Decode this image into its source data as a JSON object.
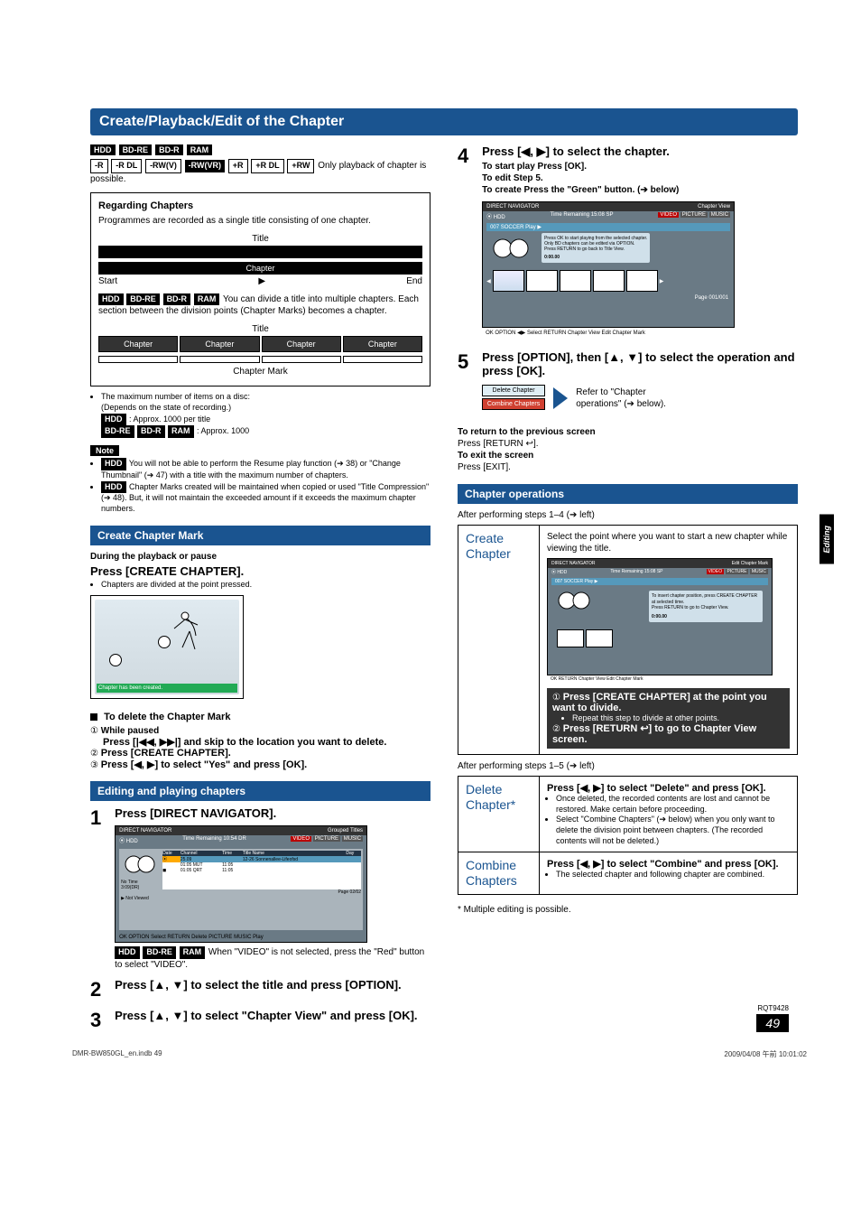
{
  "heading": "Create/Playback/Edit of the Chapter",
  "media_badges_line1": [
    "HDD",
    "BD-RE",
    "BD-R",
    "RAM"
  ],
  "media_badges_line2": [
    "-R",
    "-R DL",
    "-RW(V)",
    "-RW(VR)",
    "+R",
    "+R DL",
    "+RW"
  ],
  "media_line2_tail": "Only playback of chapter is possible.",
  "regarding": {
    "title": "Regarding Chapters",
    "desc": "Programmes are recorded as a single title consisting of one chapter.",
    "title_label": "Title",
    "chapter_label": "Chapter",
    "start": "Start",
    "end": "End",
    "divide_badges": [
      "HDD",
      "BD-RE",
      "BD-R",
      "RAM"
    ],
    "divide_text": "You can divide a title into multiple chapters. Each section between the division points (Chapter Marks) becomes a chapter.",
    "chapter_cell": "Chapter",
    "chapter_mark": "Chapter Mark"
  },
  "disc_notes": {
    "intro": "The maximum number of items on a disc:",
    "depends": "(Depends on the state of recording.)",
    "hdd_badge": "HDD",
    "hdd_text": ": Approx. 1000 per title",
    "other_badges": [
      "BD-RE",
      "BD-R",
      "RAM"
    ],
    "other_text": ": Approx. 1000"
  },
  "note": {
    "label": "Note",
    "b1_badge": "HDD",
    "b1": "You will not be able to perform the Resume play function (➔ 38) or \"Change Thumbnail\" (➔ 47) with a title with the maximum number of chapters.",
    "b2_badge": "HDD",
    "b2": "Chapter Marks created will be maintained when copied or used \"Title Compression\" (➔ 48). But, it will not maintain the exceeded amount if it exceeds the maximum chapter numbers."
  },
  "create_mark": {
    "heading": "Create Chapter Mark",
    "during": "During the playback or pause",
    "press": "Press [CREATE CHAPTER].",
    "divided": "Chapters are divided at the point pressed.",
    "created": "Chapter has been created."
  },
  "delete_mark": {
    "heading": "To delete the Chapter Mark",
    "s1_label": "While paused",
    "s1": "Press [|◀◀, ▶▶|] and skip to the location you want to delete.",
    "s2": "Press [CREATE CHAPTER].",
    "s3": "Press [◀, ▶] to select \"Yes\" and press [OK]."
  },
  "editing": {
    "heading": "Editing and playing chapters",
    "step1_title": "Press [DIRECT NAVIGATOR].",
    "nav": {
      "title": "DIRECT NAVIGATOR",
      "grouped": "Grouped Titles",
      "hdd": "HDD",
      "time_remaining": "Time Remaining  10:54  DR",
      "tabs": [
        "VIDEO",
        "PICTURE",
        "MUSIC"
      ],
      "cols": [
        "Date",
        "Channel",
        "Time",
        "Title Name",
        "Day"
      ],
      "rows": [
        [
          "25.09",
          "",
          "",
          "12-26 Sonnenallee-Lifeofsd",
          ""
        ],
        [
          "",
          "01:05 MUT",
          "11:05",
          "",
          ""
        ],
        [
          "",
          "01:05 QRT",
          "11:05",
          "",
          ""
        ]
      ],
      "no_time": "No Time",
      "code": "3:09(DR)",
      "not_viewed": "Not Viewed",
      "page": "Page 02/02",
      "footer": "OK  OPTION  Select  RETURN  Delete  PICTURE  MUSIC  Play"
    },
    "nav_note_badges": [
      "HDD",
      "BD-RE",
      "RAM"
    ],
    "nav_note": "When \"VIDEO\" is not selected, press the \"Red\" button to select \"VIDEO\".",
    "step2_title": "Press [▲, ▼] to select the title and press [OPTION].",
    "step3_title": "Press [▲, ▼] to select \"Chapter View\" and press [OK].",
    "step4_title": "Press [◀, ▶] to select the chapter.",
    "step4_sub1": "To start play  Press [OK].",
    "step4_sub2": "To edit  Step 5.",
    "step4_sub3": "To create  Press the \"Green\" button. (➔ below)",
    "chapter_view": {
      "title": "DIRECT NAVIGATOR",
      "sub": "Chapter View",
      "hdd": "HDD",
      "time_remaining": "Time Remaining  15:08  SP",
      "tabs": [
        "VIDEO",
        "PICTURE",
        "MUSIC"
      ],
      "row": "007   SOCCER        Play ▶",
      "info1": "Press OK to start playing from the selected chapter.",
      "info2": "Only BD chapters can be edited via OPTION.",
      "info3": "Press RETURN to go back to Title View.",
      "time": "0:00.00",
      "page": "Page 001/001",
      "footer": "OK  OPTION  ◀▶ Select  RETURN  Chapter View   Edit Chapter Mark"
    },
    "step5_title": "Press [OPTION], then [▲, ▼] to select the operation and press [OK].",
    "op_delete": "Delete Chapter",
    "op_combine": "Combine Chapters",
    "op_ref": "Refer to \"Chapter operations\" (➔ below).",
    "return_prev_h": "To return to the previous screen",
    "return_prev": "Press [RETURN ↩].",
    "exit_h": "To exit the screen",
    "exit": "Press [EXIT]."
  },
  "chapter_ops": {
    "heading": "Chapter operations",
    "after14": "After performing steps 1–4 (➔ left)",
    "create_label": "Create Chapter",
    "create_desc": "Select the point where you want to start a new chapter while viewing the title.",
    "ecp": {
      "title": "DIRECT NAVIGATOR",
      "sub": "Edit Chapter Mark",
      "hdd": "HDD",
      "time_remaining": "Time Remaining  15:08  SP",
      "tabs": [
        "VIDEO",
        "PICTURE",
        "MUSIC"
      ],
      "row": "007   SOCCER        Play ▶",
      "info1": "To insert chapter position, press CREATE CHAPTER at selected time.",
      "info2": "Press RETURN to go to Chapter View.",
      "time": "0:00.00",
      "footer": "OK  RETURN  Chapter View   Edit Chapter Mark"
    },
    "create_s1": "Press [CREATE CHAPTER] at the point you want to divide.",
    "create_s1_note": "Repeat this step to divide at other points.",
    "create_s2": "Press [RETURN ↩] to go to Chapter View screen.",
    "after15": "After performing steps 1–5 (➔ left)",
    "delete_label": "Delete Chapter*",
    "delete_press": "Press [◀, ▶] to select \"Delete\" and press [OK].",
    "delete_b1": "Once deleted, the recorded contents are lost and cannot be restored. Make certain before proceeding.",
    "delete_b2": "Select \"Combine Chapters\" (➔ below) when you only want to delete the division point between chapters. (The recorded contents will not be deleted.)",
    "combine_label": "Combine Chapters",
    "combine_press": "Press [◀, ▶] to select \"Combine\" and press [OK].",
    "combine_b1": "The selected chapter and following chapter are combined.",
    "footnote": "*   Multiple editing is possible."
  },
  "side_tab": "Editing",
  "rqt": "RQT9428",
  "page_num": "49",
  "footer_left": "DMR-BW850GL_en.indb   49",
  "footer_right": "2009/04/08   午前 10:01:02"
}
